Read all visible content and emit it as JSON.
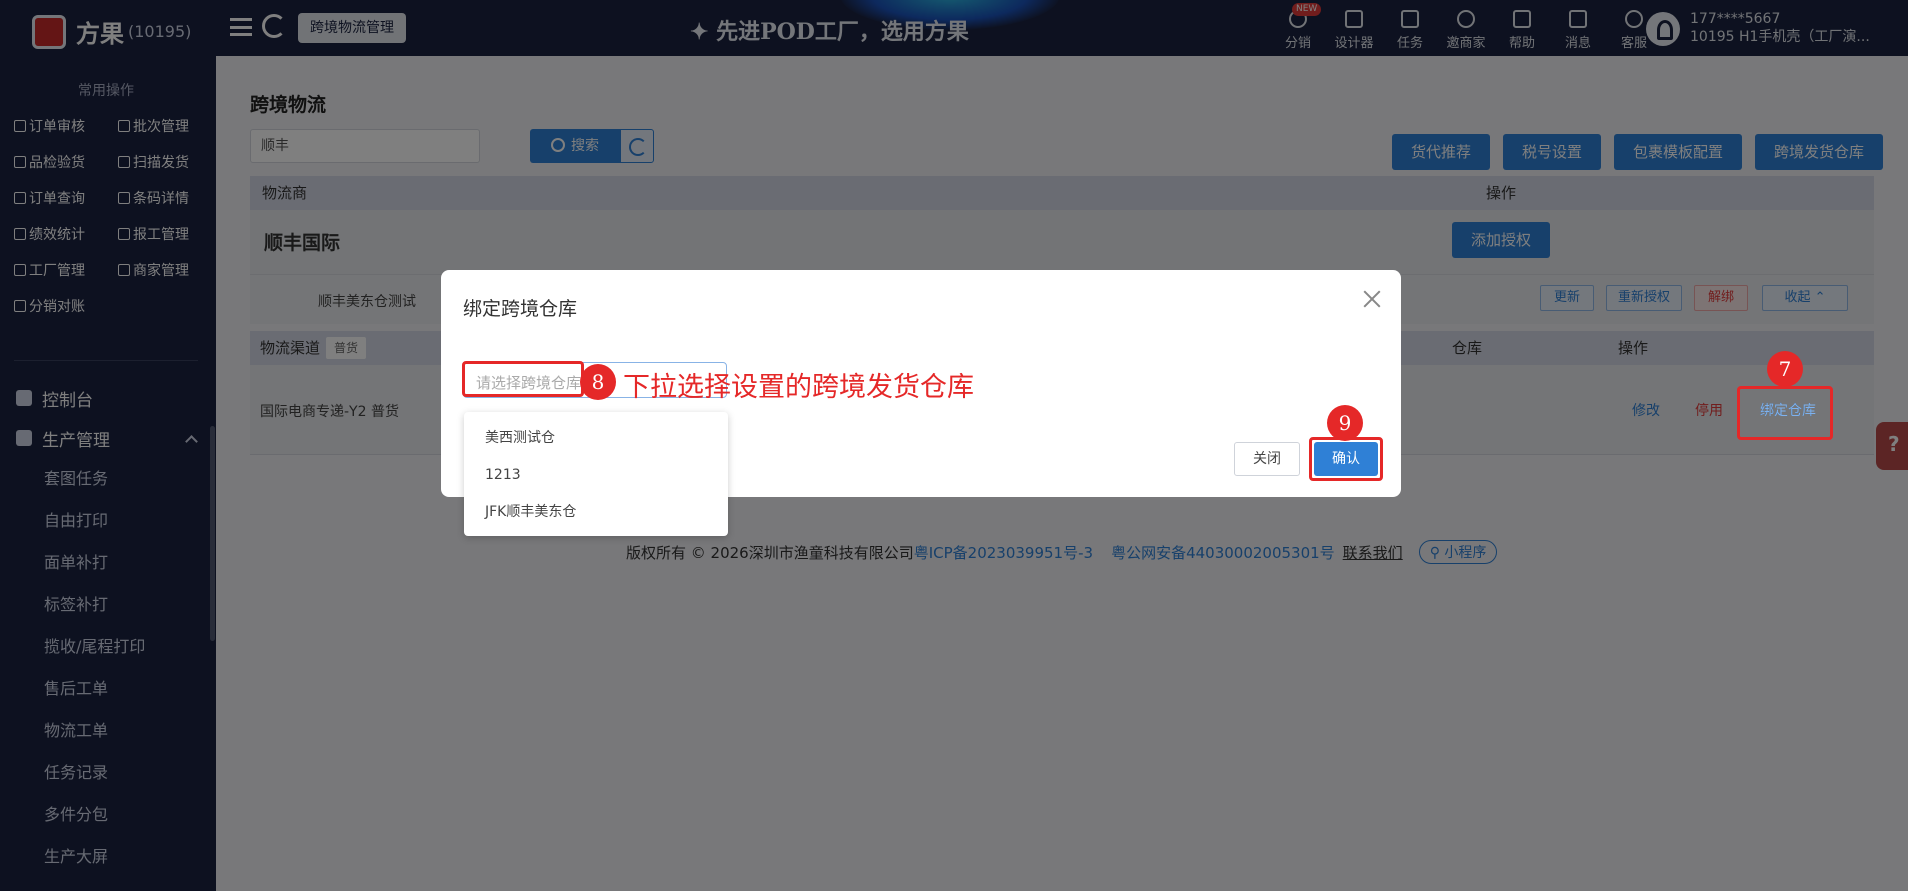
{
  "topbar": {
    "brand": "方果",
    "brand_count": "(10195)",
    "current_tag": "跨境物流管理",
    "banner_text": "✦ 先进POD工厂，选用方果",
    "icons": [
      {
        "label": "分销",
        "icon": "distribution-icon",
        "badge": "NEW"
      },
      {
        "label": "设计器",
        "icon": "designer-icon"
      },
      {
        "label": "任务",
        "icon": "task-icon"
      },
      {
        "label": "邀商家",
        "icon": "invite-icon"
      },
      {
        "label": "帮助",
        "icon": "help-icon"
      },
      {
        "label": "消息",
        "icon": "message-icon"
      },
      {
        "label": "客服",
        "icon": "service-icon"
      }
    ],
    "user_phone": "177****5667",
    "user_company": "10195 H1手机壳（工厂演..."
  },
  "sidebar": {
    "quick_title": "常用操作",
    "quick_items": [
      "订单审核",
      "批次管理",
      "品检验货",
      "扫描发货",
      "订单查询",
      "条码详情",
      "绩效统计",
      "报工管理",
      "工厂管理",
      "商家管理",
      "分销对账"
    ],
    "nav_console": "控制台",
    "nav_production": "生产管理",
    "production_items": [
      "套图任务",
      "自由打印",
      "面单补打",
      "标签补打",
      "揽收/尾程打印",
      "售后工单",
      "物流工单",
      "任务记录",
      "多件分包",
      "生产大屏"
    ]
  },
  "main": {
    "title": "跨境物流",
    "search_value": "顺丰",
    "search_button": "搜索",
    "action_buttons": [
      "货代推荐",
      "税号设置",
      "包裹模板配置",
      "跨境发货仓库"
    ],
    "col_provider": "物流商",
    "col_action": "操作",
    "provider_name": "顺丰国际",
    "add_auth": "添加授权",
    "sub_account": "顺丰美东仓测试",
    "sub_buttons": [
      "更新",
      "重新授权",
      "解绑",
      "收起"
    ],
    "channel_header": "物流渠道",
    "channel_tag": "普货",
    "col_warehouse": "仓库",
    "col_channel_action": "操作",
    "channel_name": "国际电商专递-Y2 普货",
    "channel_links": [
      "修改",
      "停用",
      "绑定仓库"
    ]
  },
  "footer": {
    "copyright": "版权所有 © 2026深圳市渔童科技有限公司",
    "icp": "粤ICP备2023039951号-3",
    "police": "粤公网安备44030002005301号",
    "contact": "联系我们",
    "mini_program": "小程序"
  },
  "modal": {
    "title": "绑定跨境仓库",
    "select_placeholder": "请选择跨境仓库",
    "options": [
      "美西测试仓",
      "1213",
      "JFK顺丰美东仓"
    ],
    "close_button": "关闭",
    "confirm_button": "确认"
  },
  "annotations": {
    "step7": "7",
    "step8": "8",
    "step9": "9",
    "hint": "下拉选择设置的跨境发货仓库",
    "color": "#e52828"
  }
}
